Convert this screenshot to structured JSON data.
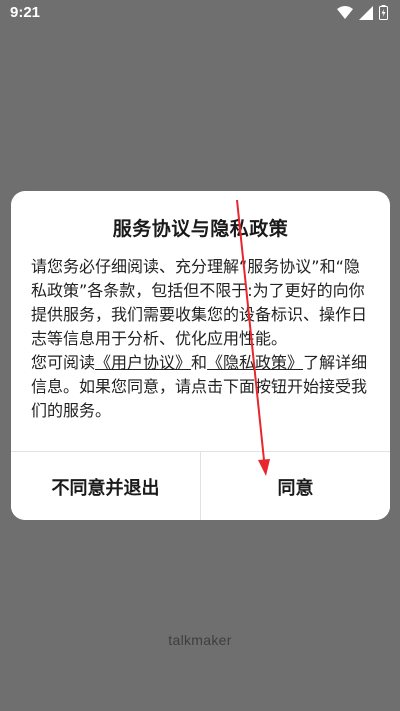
{
  "status_bar": {
    "time": "9:21"
  },
  "dialog": {
    "title": "服务协议与隐私政策",
    "paragraph1": "请您务必仔细阅读、充分理解“服务协议”和“隐私政策”各条款，包括但不限于:为了更好的向你提供服务，我们需要收集您的设备标识、操作日志等信息用于分析、优化应用性能。",
    "paragraph2_prefix": "您可阅读",
    "user_agreement_link": "《用户协议》",
    "paragraph2_middle": "和",
    "privacy_policy_link": "《隐私政策》",
    "paragraph2_suffix": "了解详细信息。如果您同意，请点击下面按钮开始接受我们的服务。",
    "disagree_button": "不同意并退出",
    "agree_button": "同意"
  },
  "app_name": "talkmaker",
  "colors": {
    "backdrop": "#6f6f6f",
    "dialog_bg": "#ffffff",
    "annotation_arrow": "#e8262d"
  },
  "icons": [
    "wifi-icon",
    "signal-icon",
    "battery-icon"
  ]
}
